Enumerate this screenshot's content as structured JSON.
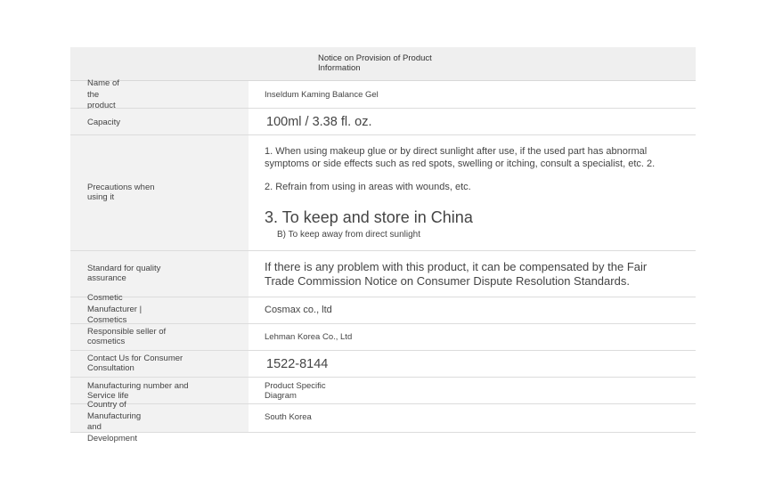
{
  "header": {
    "title": "Notice on Provision of Product Information"
  },
  "rows": {
    "name": {
      "label": "Name of the product",
      "value": "Inseldum Kaming Balance Gel"
    },
    "capacity": {
      "label": "Capacity",
      "value": "100ml / 3.38 fl. oz."
    },
    "precautions": {
      "label": "Precautions when using it",
      "p1": "1. When using makeup glue or by direct sunlight after use, if the used part has abnormal symptoms or side effects such as red spots, swelling or itching, consult a specialist, etc. 2.",
      "p2": "2. Refrain from using in areas with wounds, etc.",
      "p3": "3. To keep and store in China",
      "p4": "B) To keep away from direct sunlight"
    },
    "quality": {
      "label": "Standard for quality assurance",
      "value": "If there is any problem with this product, it can be compensated by the Fair Trade Commission Notice on Consumer Dispute Resolution Standards."
    },
    "manufacturer": {
      "label": "Cosmetic Manufacturer | Cosmetics Manufacturer",
      "value": "Cosmax co., ltd"
    },
    "seller": {
      "label": "Responsible seller of cosmetics",
      "value": "Lehman Korea Co., Ltd"
    },
    "contact": {
      "label": "Contact Us for Consumer Consultation",
      "value": "1522-8144"
    },
    "mfg_number": {
      "label": "Manufacturing number and Service life",
      "value": "Product Specific Diagram"
    },
    "origin": {
      "label": "Country of Manufacturing and Development",
      "value": "South Korea"
    }
  }
}
